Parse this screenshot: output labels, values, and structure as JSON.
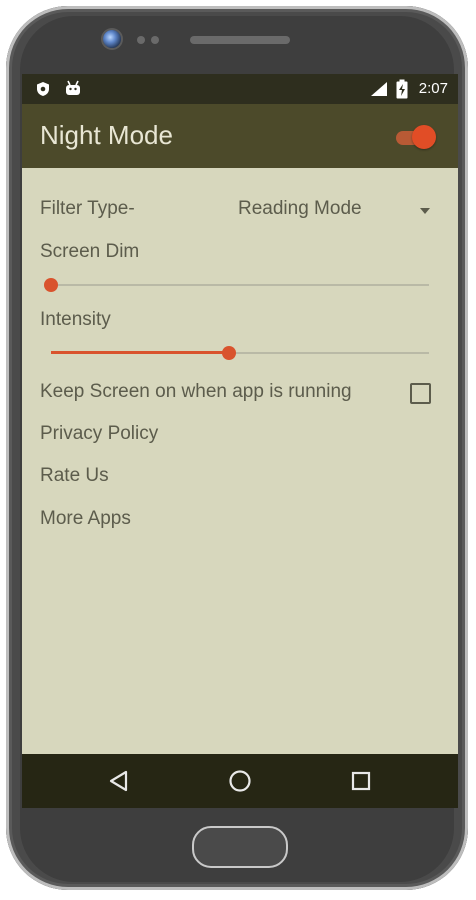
{
  "status_bar": {
    "time": "2:07",
    "left_icons": [
      "shield-icon",
      "android-icon"
    ],
    "right_icons": [
      "signal-icon",
      "battery-charging-icon"
    ]
  },
  "toolbar": {
    "title": "Night Mode",
    "toggle_on": true,
    "toggle_color": "#e14d26"
  },
  "settings": {
    "filter_type_label": "Filter Type-",
    "filter_type_value": "Reading Mode",
    "screen_dim_label": "Screen Dim",
    "screen_dim_value": 0,
    "intensity_label": "Intensity",
    "intensity_value": 0.47,
    "keep_screen_label": "Keep Screen on when app is running",
    "keep_screen_checked": false,
    "privacy_policy": "Privacy Policy",
    "rate_us": "Rate Us",
    "more_apps": "More Apps"
  },
  "nav_bar": {
    "back": "back-icon",
    "home": "home-icon",
    "recents": "recents-icon"
  },
  "colors": {
    "screen_bg": "#d7d7bd",
    "toolbar_bg": "#4c4a2a",
    "accent": "#d9532d",
    "text": "#5c5c4c"
  }
}
